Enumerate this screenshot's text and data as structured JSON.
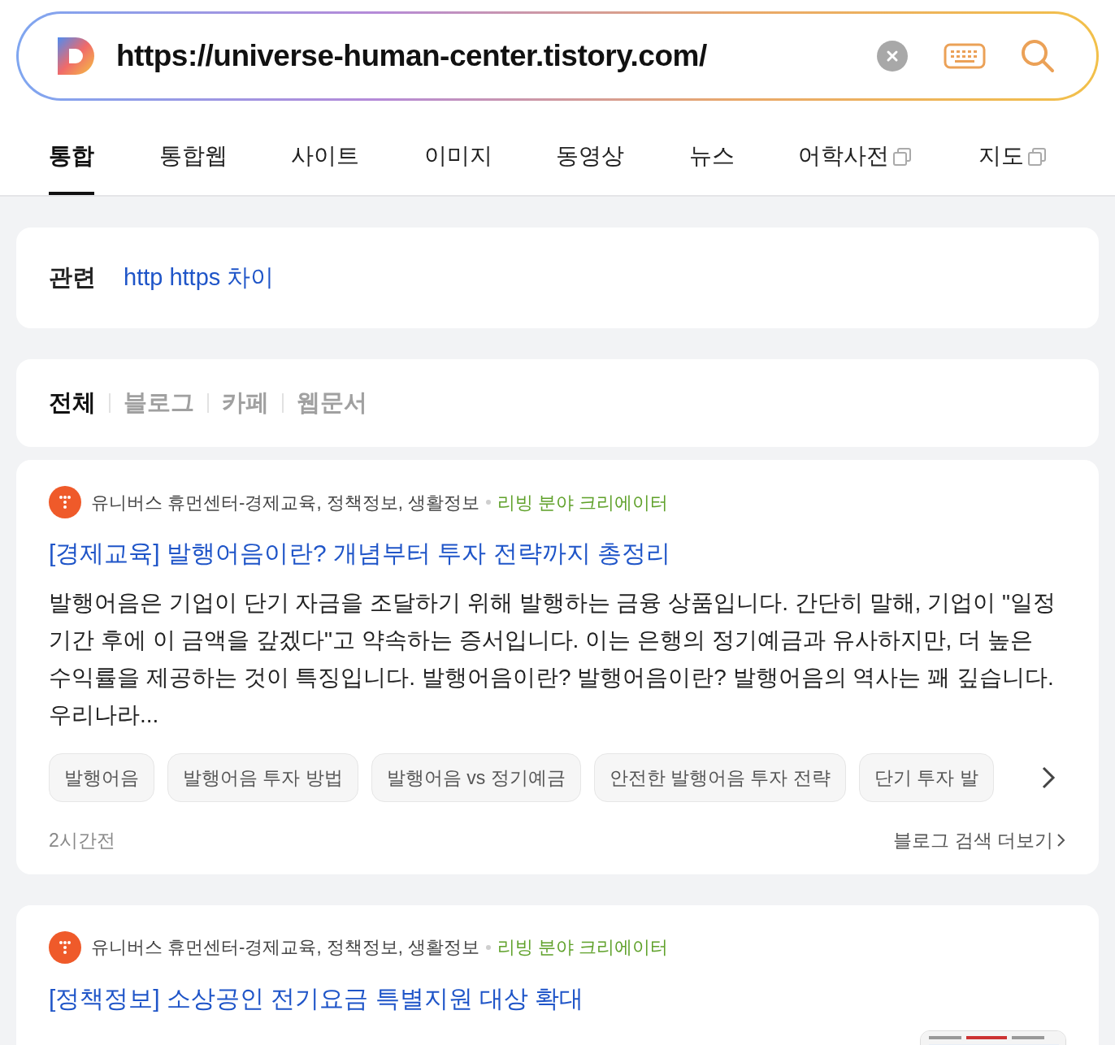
{
  "search": {
    "value": "https://universe-human-center.tistory.com/"
  },
  "tabs": [
    {
      "label": "통합",
      "selected": true,
      "external": false
    },
    {
      "label": "통합웹",
      "selected": false,
      "external": false
    },
    {
      "label": "사이트",
      "selected": false,
      "external": false
    },
    {
      "label": "이미지",
      "selected": false,
      "external": false
    },
    {
      "label": "동영상",
      "selected": false,
      "external": false
    },
    {
      "label": "뉴스",
      "selected": false,
      "external": false
    },
    {
      "label": "어학사전",
      "selected": false,
      "external": true
    },
    {
      "label": "지도",
      "selected": false,
      "external": true
    }
  ],
  "related": {
    "label": "관련",
    "items": [
      "http https 차이"
    ]
  },
  "filters": [
    {
      "label": "전체",
      "selected": true
    },
    {
      "label": "블로그",
      "selected": false
    },
    {
      "label": "카페",
      "selected": false
    },
    {
      "label": "웹문서",
      "selected": false
    }
  ],
  "results": [
    {
      "source": "유니버스 휴먼센터-경제교육, 정책정보, 생활정보",
      "badge": "리빙 분야 크리에이터",
      "title": "[경제교육] 발행어음이란? 개념부터 투자 전략까지 총정리",
      "snippet": "발행어음은 기업이 단기 자금을 조달하기 위해 발행하는 금융 상품입니다. 간단히 말해, 기업이 \"일정 기간 후에 이 금액을 갚겠다\"고 약속하는 증서입니다. 이는 은행의 정기예금과 유사하지만, 더 높은 수익률을 제공하는 것이 특징입니다. 발행어음이란? 발행어음이란? 발행어음의 역사는 꽤 깊습니다. 우리나라...",
      "tags": [
        "발행어음",
        "발행어음 투자 방법",
        "발행어음 vs 정기예금",
        "안전한 발행어음 투자 전략",
        "단기 투자 발"
      ],
      "time": "2시간전",
      "more": "블로그 검색 더보기"
    },
    {
      "source": "유니버스 휴먼센터-경제교육, 정책정보, 생활정보",
      "badge": "리빙 분야 크리에이터",
      "title": "[정책정보] 소상공인 전기요금 특별지원 대상 확대"
    }
  ]
}
